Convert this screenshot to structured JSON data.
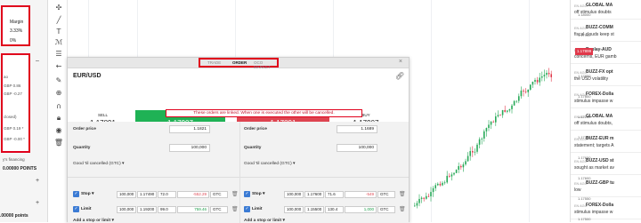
{
  "left_panel": {
    "margin_label": "Margin",
    "margin_pct": "3.33%",
    "margin_zero": "0%",
    "section_label": "ao",
    "rows": [
      "GBP 0.86",
      "GBP -0.27",
      "",
      "GBP 0.19 *",
      "GBP -0.00 *"
    ],
    "closed_label": "closed)",
    "financing": "y's financing",
    "points": "0.00000 POINTS",
    "bottom_points": ".00000 points"
  },
  "news": [
    {
      "time": "EN AGO",
      "head": "GLOBAL MA",
      "sub": "off stimulus doubts"
    },
    {
      "time": "EN AGO",
      "head": "BUZZ-COMM",
      "sub": "fiscal clouds keep st"
    },
    {
      "time": "EN AGO",
      "head": "Replay-AUD",
      "sub": "concerns, EUR gamb"
    },
    {
      "time": "EN AGO",
      "head": "BUZZ-FX opt",
      "sub": "the USD volatility"
    },
    {
      "time": "EN AGO",
      "head": "FOREX-Dolla",
      "sub": "stimulus impasse w"
    },
    {
      "time": "EN AGO",
      "head": "GLOBAL MA",
      "sub": "off stimulus doubts,"
    },
    {
      "time": "EN AGO",
      "head": "BUZZ-EUR m",
      "sub": "statement; targets A"
    },
    {
      "time": "EN AGO",
      "head": "BUZZ-USD st",
      "sub": "sought as market av"
    },
    {
      "time": "EN AGO",
      "head": "BUZZ-GBP tu",
      "sub": "low"
    },
    {
      "time": "EN AGO",
      "head": "FOREX-Dolla",
      "sub": "stimulus impasse w"
    }
  ],
  "price_axis": [
    "1.18000",
    "1.17950",
    "1.17899",
    "1.17850",
    "1.17800",
    "1.17750",
    "1.17700",
    "1.17650",
    "1.17600",
    "1.17550",
    "1.17500"
  ],
  "current_price": "1.17899",
  "dialog": {
    "tabs": [
      "TRADE",
      "ORDER",
      "OCO MARKET"
    ],
    "pair": "EUR/USD",
    "left": {
      "sell_label": "SELL",
      "sell_value": "1.17891",
      "buy_label": "BUY",
      "buy_value": "1.17907",
      "spread": "1.6"
    },
    "right": {
      "sell_label": "SELL",
      "sell_value": "1.17891",
      "buy_label": "BUY",
      "buy_value": "1.17907",
      "spread": "1.6"
    },
    "linked_msg": "These orders are linked. When one is executed the other will be cancelled.",
    "order_price_label": "Order price",
    "quantity_label": "Quantity",
    "left_order_price": "1.1821",
    "left_quantity": "100,000",
    "right_order_price": "1.1689",
    "right_quantity": "100,000",
    "gtc_label": "Good 'til cancelled (GTC) ▾",
    "stop_label": "Stop",
    "limit_label": "Limit",
    "left_stop": [
      "100,000",
      "1.17490",
      "72.0",
      "-552.29",
      "GTC"
    ],
    "left_limit": [
      "100,000",
      "1.19200",
      "99.0",
      "759.46",
      "GTC"
    ],
    "right_stop": [
      "100,000",
      "1.17600",
      "71.6",
      "-549",
      "GTC"
    ],
    "right_limit": [
      "100,000",
      "1.15500",
      "130.4",
      "1,000",
      "GTC"
    ],
    "add_stop": "Add a stop or limit ▾"
  }
}
